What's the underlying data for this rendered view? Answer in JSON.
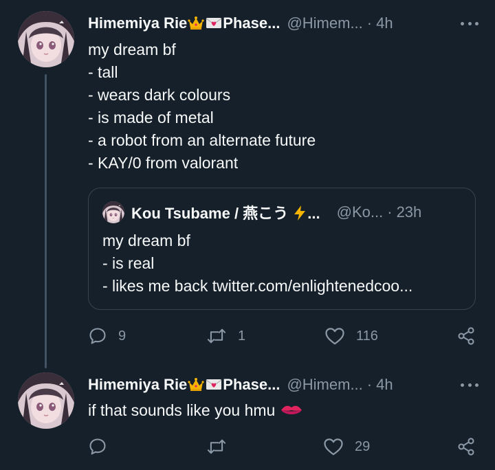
{
  "colors": {
    "background": "#15202b",
    "text_primary": "#f7f9f9",
    "text_secondary": "#8b98a5",
    "border": "#38444d",
    "thread_line": "#425364"
  },
  "tweets": [
    {
      "display_name_start": "Himemiya Rie",
      "display_name_end": "Phase...",
      "name_emojis": [
        "crown-emoji",
        "love-letter-emoji"
      ],
      "handle": "@Himem...",
      "separator": "·",
      "time": "4h",
      "text": "my dream bf\n- tall\n- wears dark colours\n- is made of metal\n- a robot from an alternate future\n- KAY/0 from valorant",
      "quote": {
        "display_name": "Kou Tsubame / 燕こう",
        "name_emoji": "lightning-emoji",
        "name_ellipsis": "...",
        "handle": "@Ko...",
        "separator": "·",
        "time": "23h",
        "text": "my dream bf\n- is real\n- likes me back twitter.com/enlightenedcoo..."
      },
      "actions": {
        "replies": "9",
        "retweets": "1",
        "likes": "116",
        "share_icon": "share-icon"
      }
    },
    {
      "display_name_start": "Himemiya Rie",
      "display_name_end": "Phase...",
      "name_emojis": [
        "crown-emoji",
        "love-letter-emoji"
      ],
      "handle": "@Himem...",
      "separator": "·",
      "time": "4h",
      "text": "if that sounds like you hmu",
      "text_emoji": "kiss-mark-emoji",
      "actions": {
        "replies": "",
        "retweets": "",
        "likes": "29",
        "share_icon": "share-icon"
      }
    }
  ]
}
